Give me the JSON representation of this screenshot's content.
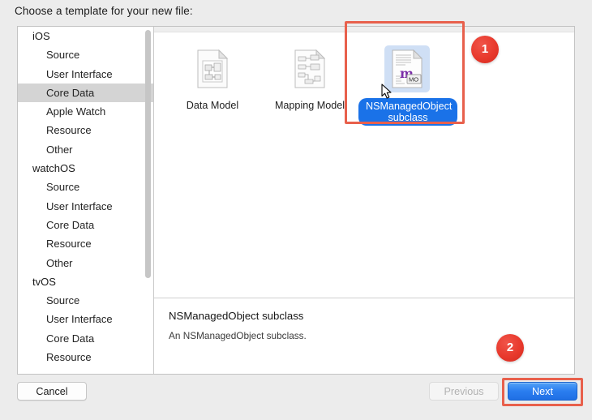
{
  "dialog": {
    "prompt": "Choose a template for your new file:"
  },
  "sidebar": {
    "items": [
      {
        "label": "iOS",
        "level": "group",
        "selected": false
      },
      {
        "label": "Source",
        "level": "child",
        "selected": false
      },
      {
        "label": "User Interface",
        "level": "child",
        "selected": false
      },
      {
        "label": "Core Data",
        "level": "child",
        "selected": true
      },
      {
        "label": "Apple Watch",
        "level": "child",
        "selected": false
      },
      {
        "label": "Resource",
        "level": "child",
        "selected": false
      },
      {
        "label": "Other",
        "level": "child",
        "selected": false
      },
      {
        "label": "watchOS",
        "level": "group",
        "selected": false
      },
      {
        "label": "Source",
        "level": "child",
        "selected": false
      },
      {
        "label": "User Interface",
        "level": "child",
        "selected": false
      },
      {
        "label": "Core Data",
        "level": "child",
        "selected": false
      },
      {
        "label": "Resource",
        "level": "child",
        "selected": false
      },
      {
        "label": "Other",
        "level": "child",
        "selected": false
      },
      {
        "label": "tvOS",
        "level": "group",
        "selected": false
      },
      {
        "label": "Source",
        "level": "child",
        "selected": false
      },
      {
        "label": "User Interface",
        "level": "child",
        "selected": false
      },
      {
        "label": "Core Data",
        "level": "child",
        "selected": false
      },
      {
        "label": "Resource",
        "level": "child",
        "selected": false
      }
    ]
  },
  "templates": [
    {
      "label": "Data Model",
      "icon": "data-model-icon",
      "selected": false
    },
    {
      "label": "Mapping Model",
      "icon": "mapping-model-icon",
      "selected": false
    },
    {
      "label": "NSManagedObject subclass",
      "icon": "nsmanagedobject-icon",
      "selected": true
    }
  ],
  "description": {
    "title": "NSManagedObject subclass",
    "body": "An NSManagedObject subclass."
  },
  "buttons": {
    "cancel": "Cancel",
    "previous": "Previous",
    "next": "Next"
  },
  "annotations": {
    "badge_1": "1",
    "badge_2": "2",
    "color": "#e8604c"
  },
  "icon_text": {
    "mo_badge": "MO",
    "mo_letter": "m"
  }
}
